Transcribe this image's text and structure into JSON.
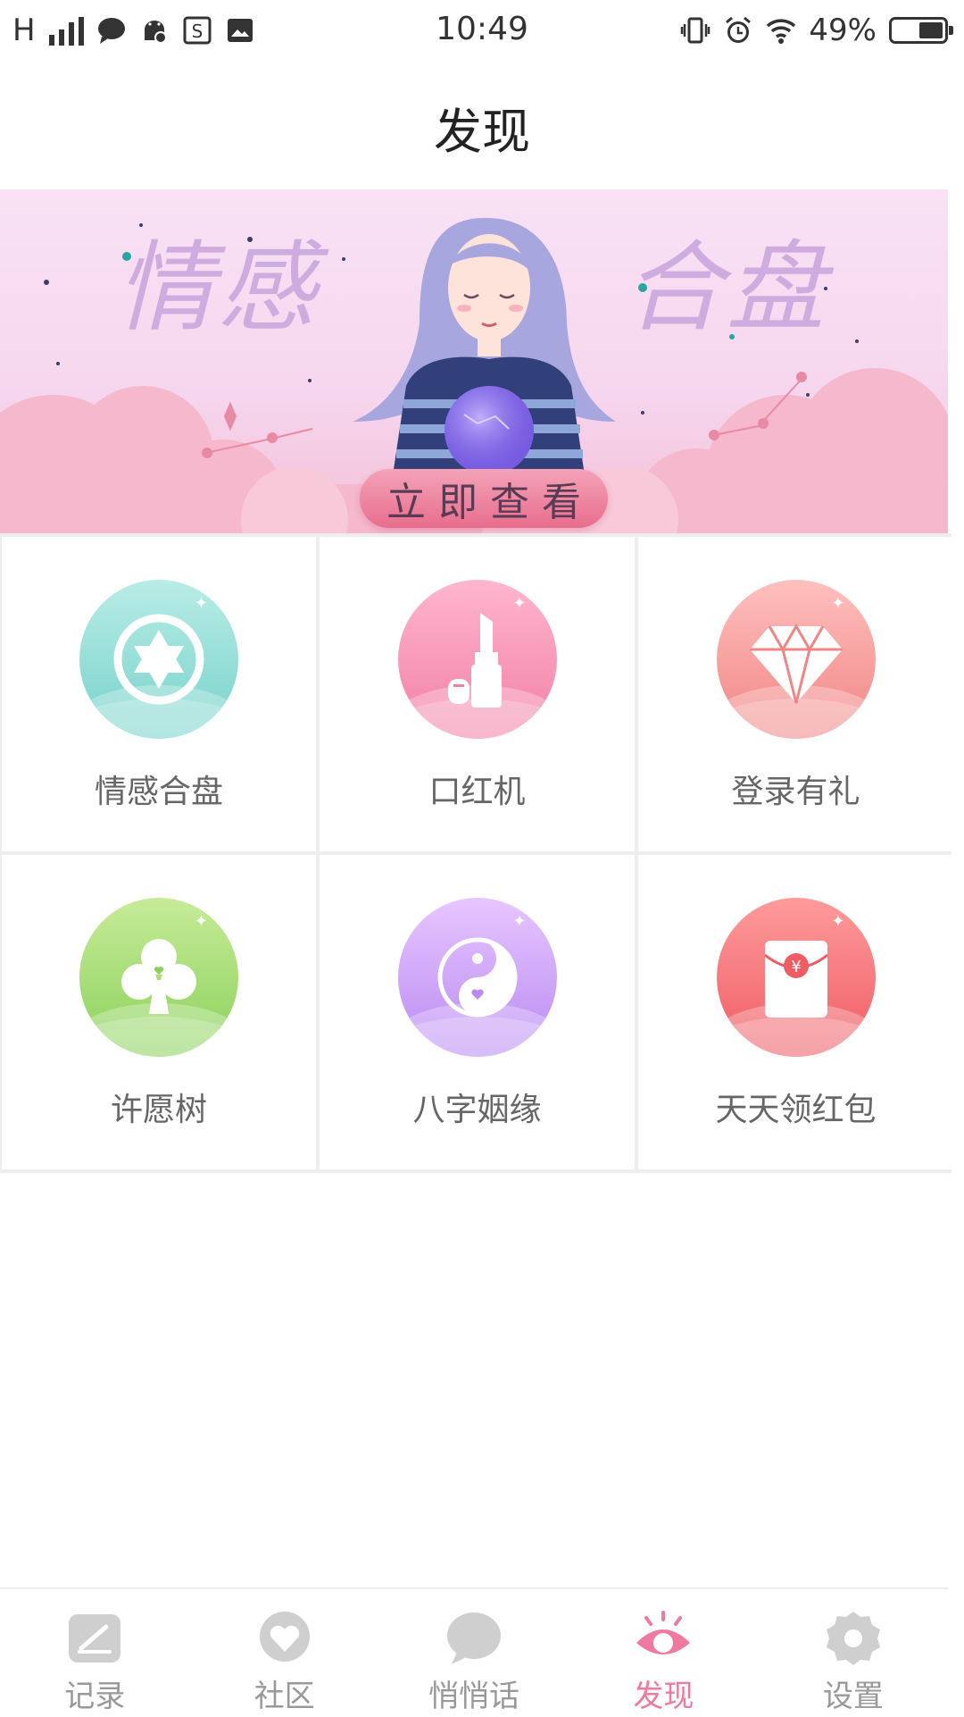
{
  "status_bar": {
    "network": "H",
    "time": "10:49",
    "battery": "49%",
    "battery_level": 0.49,
    "icons": [
      "signal-icon",
      "message-icon",
      "android-debug-icon",
      "app-s-icon",
      "image-icon",
      "vibrate-icon",
      "alarm-icon",
      "wifi-icon",
      "battery-icon"
    ]
  },
  "header": {
    "title": "发现"
  },
  "banner": {
    "text_left": "情感",
    "text_right": "合盘",
    "cta_label": "立即查看",
    "colors": {
      "bg": "#f9e2f5",
      "cta": "#e86d8d"
    }
  },
  "grid": {
    "items": [
      {
        "label": "情感合盘",
        "icon": "star-of-david-icon",
        "color": "#76d2cb"
      },
      {
        "label": "口红机",
        "icon": "lipstick-icon",
        "color": "#f27fa6"
      },
      {
        "label": "登录有礼",
        "icon": "diamond-icon",
        "color": "#f08585"
      },
      {
        "label": "许愿树",
        "icon": "clover-icon",
        "color": "#8bd15b"
      },
      {
        "label": "八字姻缘",
        "icon": "yin-yang-icon",
        "color": "#b98af2"
      },
      {
        "label": "天天领红包",
        "icon": "red-envelope-icon",
        "color": "#ee5c64"
      }
    ]
  },
  "bottom_nav": {
    "items": [
      {
        "label": "记录",
        "icon": "pencil-note-icon",
        "active": false
      },
      {
        "label": "社区",
        "icon": "heart-bubble-icon",
        "active": false
      },
      {
        "label": "悄悄话",
        "icon": "chat-bubble-icon",
        "active": false
      },
      {
        "label": "发现",
        "icon": "eye-icon",
        "active": true
      },
      {
        "label": "设置",
        "icon": "gear-icon",
        "active": false
      }
    ],
    "active_color": "#f07a9f",
    "inactive_color": "#cfcfcf"
  }
}
